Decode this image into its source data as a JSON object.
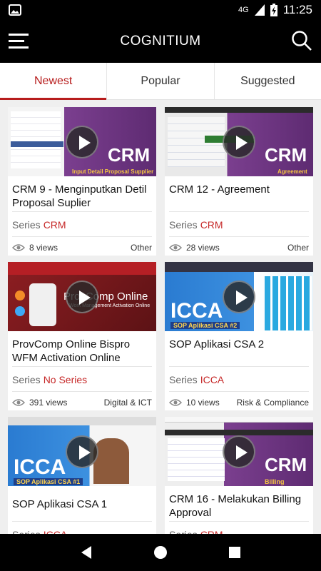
{
  "status": {
    "network": "4G",
    "time": "11:25"
  },
  "app": {
    "title": "COGNITIUM"
  },
  "tabs": [
    {
      "label": "Newest",
      "active": true
    },
    {
      "label": "Popular",
      "active": false
    },
    {
      "label": "Suggested",
      "active": false
    }
  ],
  "series_label": "Series",
  "cards": [
    {
      "title": "CRM 9 - Menginputkan Detil Proposal Suplier",
      "series": "CRM",
      "views": "8 views",
      "category": "Other",
      "thumb_text": "CRM",
      "thumb_sub": "Input Detail Proposal Supplier"
    },
    {
      "title": "CRM 12 - Agreement",
      "series": "CRM",
      "views": "28 views",
      "category": "Other",
      "thumb_text": "CRM",
      "thumb_sub": "Agreement"
    },
    {
      "title": "ProvComp Online Bispro WFM Activation Online",
      "series": "No Series",
      "views": "391 views",
      "category": "Digital & ICT",
      "thumb_text": "ProvComp Online",
      "thumb_sub": "Work Management Activation Online"
    },
    {
      "title": "SOP Aplikasi CSA 2",
      "series": "ICCA",
      "views": "10 views",
      "category": "Risk & Compliance",
      "thumb_text": "ICCA",
      "thumb_sub": "SOP Aplikasi CSA #2"
    },
    {
      "title": "SOP Aplikasi CSA 1",
      "series": "ICCA",
      "views": "",
      "category": "",
      "thumb_text": "ICCA",
      "thumb_sub": "SOP Aplikasi CSA #1"
    },
    {
      "title": "CRM 16 - Melakukan Billing Approval",
      "series": "CRM",
      "views": "",
      "category": "",
      "thumb_text": "CRM",
      "thumb_sub": "Billing Approval"
    }
  ],
  "colors": {
    "accent": "#b71c1c",
    "crm_purple": "#7b3f8f",
    "icca_blue": "#2a7bd1"
  }
}
